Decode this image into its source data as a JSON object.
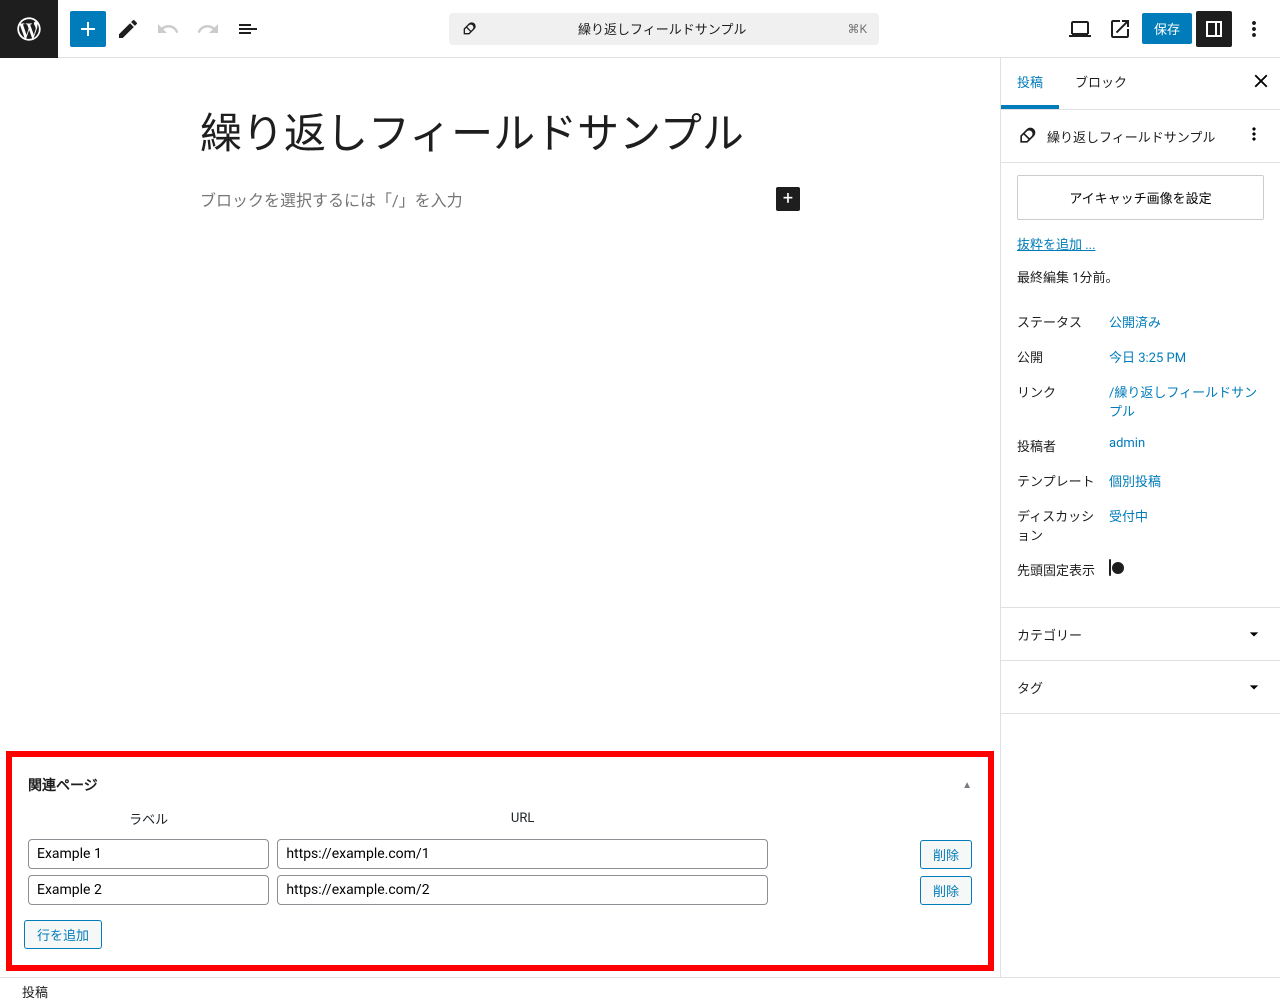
{
  "topbar": {
    "doc_title": "繰り返しフィールドサンプル",
    "shortcut": "⌘K",
    "save_label": "保存"
  },
  "editor": {
    "title": "繰り返しフィールドサンプル",
    "block_prompt": "ブロックを選択するには「/」を入力"
  },
  "metabox": {
    "panel_title": "関連ページ",
    "col_label": "ラベル",
    "col_url": "URL",
    "delete_label": "削除",
    "add_row_label": "行を追加",
    "rows": [
      {
        "label": "Example 1",
        "url": "https://example.com/1"
      },
      {
        "label": "Example 2",
        "url": "https://example.com/2"
      }
    ]
  },
  "sidebar": {
    "tabs": {
      "post": "投稿",
      "block": "ブロック"
    },
    "doc_title": "繰り返しフィールドサンプル",
    "featured_btn": "アイキャッチ画像を設定",
    "excerpt_link": "抜粋を追加 ...",
    "last_edit": "最終編集 1分前。",
    "rows": {
      "status": {
        "lbl": "ステータス",
        "val": "公開済み"
      },
      "publish": {
        "lbl": "公開",
        "val": "今日 3:25 PM"
      },
      "link": {
        "lbl": "リンク",
        "val": "/繰り返しフィールドサンプル"
      },
      "author": {
        "lbl": "投稿者",
        "val": "admin"
      },
      "template": {
        "lbl": "テンプレート",
        "val": "個別投稿"
      },
      "discussion": {
        "lbl": "ディスカッション",
        "val": "受付中"
      },
      "sticky": {
        "lbl": "先頭固定表示"
      }
    },
    "panels": {
      "category": "カテゴリー",
      "tag": "タグ"
    }
  },
  "bottombar": {
    "breadcrumb": "投稿"
  }
}
